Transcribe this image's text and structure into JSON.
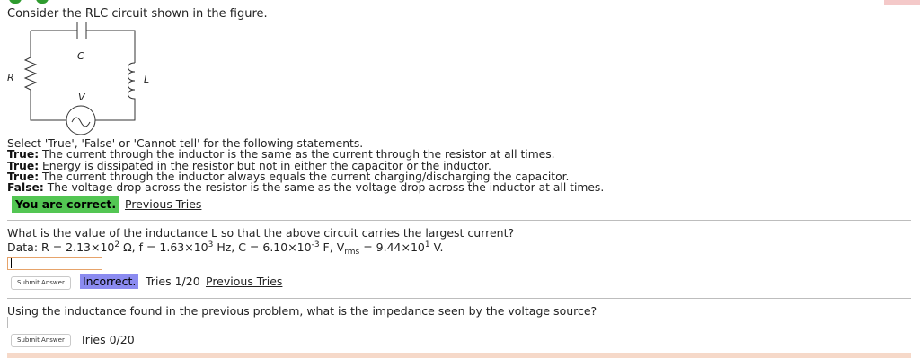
{
  "intro": "Consider the RLC circuit shown in the figure.",
  "circuit": {
    "labels": {
      "c": "C",
      "r": "R",
      "l": "L",
      "v": "V"
    }
  },
  "statements": {
    "prompt": "Select 'True', 'False' or 'Cannot tell' for the following statements.",
    "items": [
      {
        "answer": "True:",
        "text": " The current through the inductor is the same as the current through the resistor at all times."
      },
      {
        "answer": "True:",
        "text": " Energy is dissipated in the resistor but not in either the capacitor or the inductor."
      },
      {
        "answer": "True:",
        "text": " The current through the inductor always equals the current charging/discharging the capacitor."
      },
      {
        "answer": "False:",
        "text": " The voltage drop across the resistor is the same as the voltage drop across the inductor at all times."
      }
    ],
    "result": "You are correct.",
    "previous_tries": "Previous Tries"
  },
  "question2": {
    "text": "What is the value of the inductance L so that the above circuit carries the largest current?",
    "data_prefix": "Data: R = 2.13×10",
    "r_exp": "2",
    "f_part": " Ω, f = 1.63×10",
    "f_exp": "3",
    "c_part": " Hz, C = 6.10×10",
    "c_exp": "-3",
    "v_part": " F, V",
    "v_sub": "rms",
    "v_val": " = 9.44×10",
    "v_exp": "1",
    "v_unit": " V.",
    "submit_label": "Submit Answer",
    "result": "Incorrect.",
    "tries": "Tries 1/20",
    "previous_tries": "Previous Tries"
  },
  "question3": {
    "text": "Using the inductance found in the previous problem, what is the impedance seen by the voltage source?",
    "submit_label": "Submit Answer",
    "tries": "Tries 0/20"
  },
  "colors": {
    "correct": "#53c653",
    "incorrect": "#8b8bf0",
    "input_border": "#e6a36a"
  }
}
